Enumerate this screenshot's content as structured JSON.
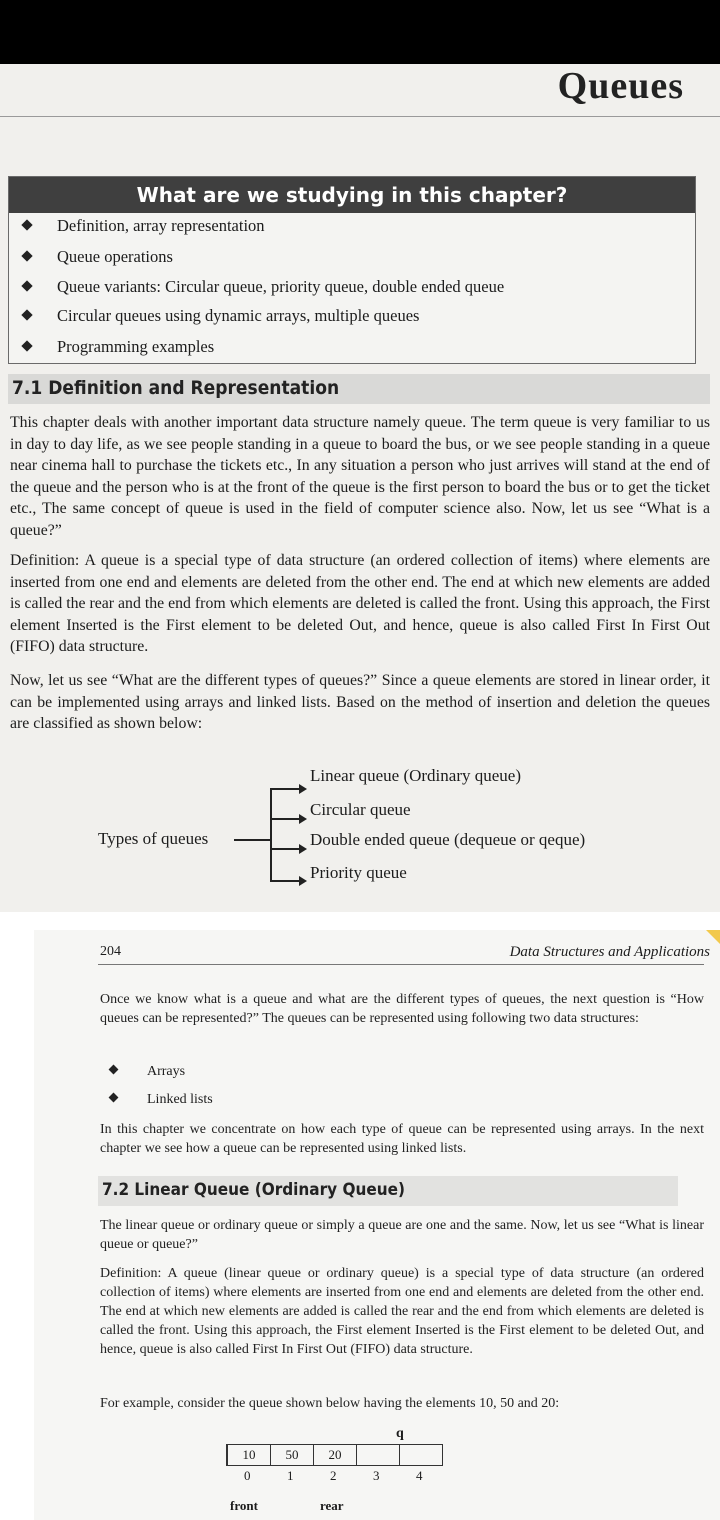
{
  "chapter": {
    "title": "Queues"
  },
  "study_box": {
    "heading": "What are we studying in this chapter?",
    "items": [
      "Definition, array representation",
      "Queue operations",
      "Queue variants: Circular queue, priority queue, double ended queue",
      "Circular queues using dynamic arrays, multiple queues",
      "Programming examples"
    ]
  },
  "section_71": {
    "heading": "7.1  Definition and Representation",
    "para1": "This chapter deals with another important data structure namely queue. The term queue is very familiar to us in day to day life, as we see people standing in a queue to board the bus, or we see people standing in a queue near cinema hall to purchase the tickets etc., In any situation a person who just arrives will stand at the end of the queue and the person who is at the front of the queue is the first person to board the bus or to get the ticket etc., The same concept of queue is used in the field of computer science also. Now, let us see “What is a queue?”",
    "para2": "Definition: A queue is a special type of data structure (an ordered collection of items) where elements are inserted from one end and elements are deleted from the other end. The end at which new elements are added is called the rear and the end from which elements are deleted is called the front. Using this approach, the First element Inserted is the First element to be deleted Out, and hence, queue is also called First In First Out (FIFO) data structure.",
    "para3": "Now, let us see “What are the different types of queues?” Since a queue elements are stored in linear order, it can be implemented using arrays and linked lists. Based on the method of insertion and deletion the queues are classified as shown below:"
  },
  "types_diagram": {
    "label": "Types of queues",
    "types": [
      "Linear queue (Ordinary queue)",
      "Circular queue",
      "Double ended queue (dequeue or qeque)",
      "Priority queue"
    ]
  },
  "page2": {
    "page_number": "204",
    "running_title": "Data Structures and Applications",
    "para1": "Once we know what is a queue and what are the different types of queues, the next question is “How queues can be represented?” The queues can be represented using following two data structures:",
    "bullets": [
      "Arrays",
      "Linked lists"
    ],
    "para2": "In this chapter we concentrate on how each type of queue can be represented using arrays. In the next chapter we see how a queue can be represented using linked lists.",
    "section_heading": "7.2  Linear Queue (Ordinary Queue)",
    "para3": "The linear queue or ordinary queue or simply a queue are one and the same. Now, let us see “What is linear queue or queue?”",
    "para4": "Definition: A queue (linear queue or ordinary queue) is a special type of data structure (an ordered collection of items) where elements are inserted from one end and elements are deleted from the other end. The end at which new elements are added is called the rear and the end from which elements are deleted is called the front. Using this approach, the First element Inserted is the First element to be deleted Out, and hence, queue is also called First In First Out (FIFO) data structure.",
    "para5": "For example, consider the queue shown below having the elements 10, 50 and 20:",
    "queue": {
      "cells": [
        "10",
        "50",
        "20",
        "",
        ""
      ],
      "indices": [
        "0",
        "1",
        "2",
        "3",
        "4"
      ],
      "cursor": "q",
      "front_label": "front",
      "rear_label": "rear"
    }
  }
}
